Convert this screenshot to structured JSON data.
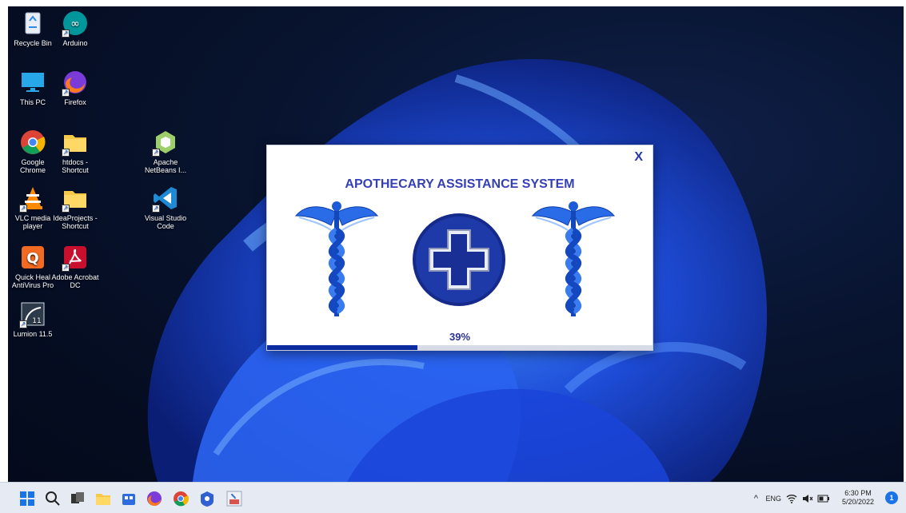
{
  "desktop": {
    "icons": [
      {
        "label": "Recycle Bin",
        "icon": "recycle-bin-icon"
      },
      {
        "label": "Arduino",
        "icon": "arduino-icon"
      },
      {
        "label": "This PC",
        "icon": "monitor-icon"
      },
      {
        "label": "Firefox",
        "icon": "firefox-icon"
      },
      {
        "label": "Google Chrome",
        "icon": "chrome-icon"
      },
      {
        "label": "htdocs - Shortcut",
        "icon": "folder-icon"
      },
      {
        "label": "Apache NetBeans I...",
        "icon": "netbeans-icon"
      },
      {
        "label": "VLC media player",
        "icon": "vlc-icon"
      },
      {
        "label": "IdeaProjects - Shortcut",
        "icon": "folder-icon"
      },
      {
        "label": "Visual Studio Code",
        "icon": "vscode-icon"
      },
      {
        "label": "Quick Heal AntiVirus Pro",
        "icon": "quickheal-icon"
      },
      {
        "label": "Adobe Acrobat DC",
        "icon": "acrobat-icon"
      },
      {
        "label": "Lumion 11.5",
        "icon": "lumion-icon"
      }
    ]
  },
  "splash": {
    "title": "APOTHECARY ASSISTANCE SYSTEM",
    "close_label": "X",
    "progress_label": "39%",
    "progress": 0.39,
    "accent_color": "#3540b5",
    "bar_color": "#0a2ca0"
  },
  "taskbar": {
    "items": [
      "windows-start-icon",
      "search-icon",
      "task-view-icon",
      "file-explorer-icon",
      "store-icon",
      "firefox-icon",
      "chrome-icon",
      "app-icon",
      "java-app-icon"
    ],
    "tray": {
      "chevron": "^",
      "language": "ENG",
      "time": "6:30 PM",
      "date": "5/20/2022",
      "notification_count": "1"
    }
  }
}
